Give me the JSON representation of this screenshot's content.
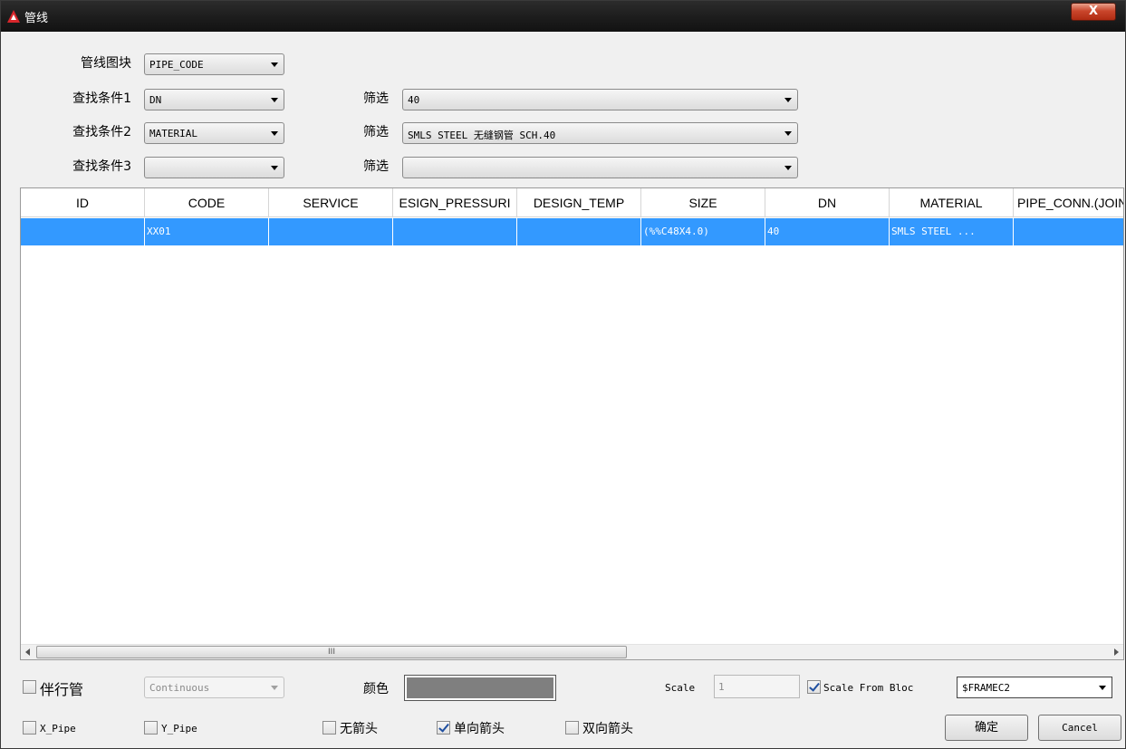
{
  "window": {
    "title": "管线",
    "close_symbol": "X",
    "logo_letter": "A"
  },
  "colors": {
    "selection": "#3399ff",
    "title_bg": "#1b1b1b",
    "close_button": "#c9462c",
    "color_swatch": "#7f7f7f"
  },
  "filters": {
    "block_label": "管线图块",
    "block_value": "PIPE_CODE",
    "conditions": [
      {
        "label": "查找条件1",
        "field": "DN",
        "filter_label": "筛选",
        "filter_value": "40"
      },
      {
        "label": "查找条件2",
        "field": "MATERIAL",
        "filter_label": "筛选",
        "filter_value": "SMLS STEEL 无缝钢管 SCH.40"
      },
      {
        "label": "查找条件3",
        "field": "",
        "filter_label": "筛选",
        "filter_value": ""
      }
    ]
  },
  "table": {
    "columns": [
      "ID",
      "CODE",
      "SERVICE",
      "ESIGN_PRESSURI",
      "DESIGN_TEMP",
      "SIZE",
      "DN",
      "MATERIAL",
      "PIPE_CONN.(JOIN"
    ],
    "rows": [
      [
        "",
        "XX01",
        "",
        "",
        "",
        "(%%C48X4.0)",
        "40",
        "SMLS STEEL ...",
        ""
      ]
    ],
    "scroll_grip": "III"
  },
  "options": {
    "companion_pipe_label": "伴行管",
    "companion_pipe_checked": false,
    "linetype_value": "Continuous",
    "color_label": "颜色",
    "scale_label": "Scale",
    "scale_value": "1",
    "scale_from_block_label": "Scale From Bloc",
    "scale_from_block_checked": true,
    "frame_value": "$FRAMEC2",
    "x_pipe_label": "X_Pipe",
    "x_pipe_checked": false,
    "y_pipe_label": "Y_Pipe",
    "y_pipe_checked": false,
    "no_arrow_label": "无箭头",
    "no_arrow_checked": false,
    "single_arrow_label": "单向箭头",
    "single_arrow_checked": true,
    "double_arrow_label": "双向箭头",
    "double_arrow_checked": false
  },
  "buttons": {
    "ok_label": "确定",
    "cancel_label": "Cancel"
  }
}
